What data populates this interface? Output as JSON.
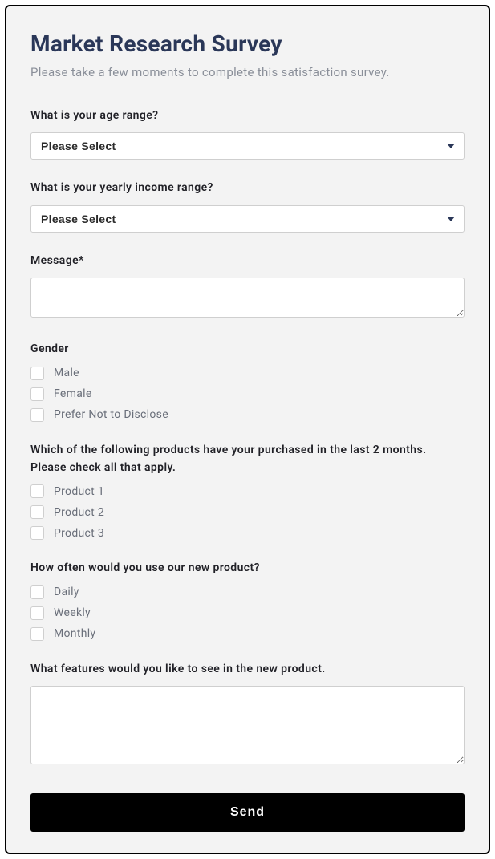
{
  "title": "Market Research Survey",
  "subtitle": "Please take a few moments to complete this satisfaction survey.",
  "fields": {
    "age": {
      "label": "What is your age range?",
      "placeholder": "Please Select"
    },
    "income": {
      "label": "What is your yearly income range?",
      "placeholder": "Please Select"
    },
    "message": {
      "label": "Message*"
    },
    "gender": {
      "label": "Gender",
      "options": [
        "Male",
        "Female",
        "Prefer Not to Disclose"
      ]
    },
    "products": {
      "label": "Which of the following products have your purchased in the last 2 months. Please check all that apply.",
      "options": [
        "Product 1",
        "Product 2",
        "Product 3"
      ]
    },
    "frequency": {
      "label": "How often would you use our new product?",
      "options": [
        "Daily",
        "Weekly",
        "Monthly"
      ]
    },
    "features": {
      "label": "What features would you like to see in the new product."
    }
  },
  "submit_label": "Send"
}
